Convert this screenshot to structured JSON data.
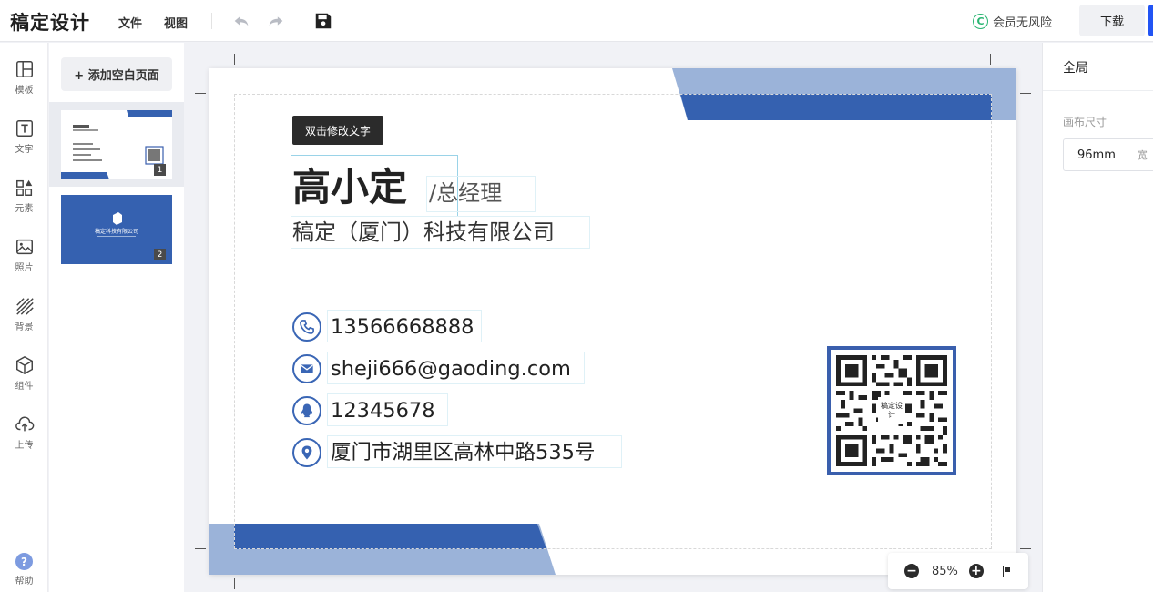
{
  "app": {
    "logo": "稿定设计",
    "menu_file": "文件",
    "menu_view": "视图",
    "undo_icon": "undo-icon",
    "redo_icon": "redo-icon",
    "save_icon": "save-icon",
    "vip_mark": "C",
    "vip_text": "会员无风险",
    "download": "下载",
    "accent": "#2254f4"
  },
  "rail": {
    "items": [
      {
        "label": "模板",
        "icon": "template-icon"
      },
      {
        "label": "文字",
        "icon": "text-icon"
      },
      {
        "label": "元素",
        "icon": "elements-icon"
      },
      {
        "label": "照片",
        "icon": "photo-icon"
      },
      {
        "label": "背景",
        "icon": "background-icon"
      },
      {
        "label": "组件",
        "icon": "component-icon"
      },
      {
        "label": "上传",
        "icon": "upload-icon"
      }
    ],
    "help": "帮助",
    "help_mark": "?"
  },
  "pages": {
    "add_label": "+ 添加空白页面",
    "thumbs": [
      {
        "num": "1"
      },
      {
        "num": "2",
        "company": "稿定科技有限公司"
      }
    ]
  },
  "card": {
    "tooltip": "双击修改文字",
    "name": "高小定",
    "title": "/总经理",
    "company": "稿定（厦门）科技有限公司",
    "phone": "13566668888",
    "email": "sheji666@gaoding.com",
    "qq": "12345678",
    "address": "厦门市湖里区高林中路535号",
    "qr_logo": "稿定设计",
    "brand_blue": "#3561b0",
    "brand_light": "#9bb3d9"
  },
  "zoom": {
    "value": "85%",
    "minus": "−",
    "plus": "+"
  },
  "props": {
    "title": "全局",
    "canvas_size_label": "画布尺寸",
    "width_value": "96mm",
    "width_unit": "宽"
  }
}
